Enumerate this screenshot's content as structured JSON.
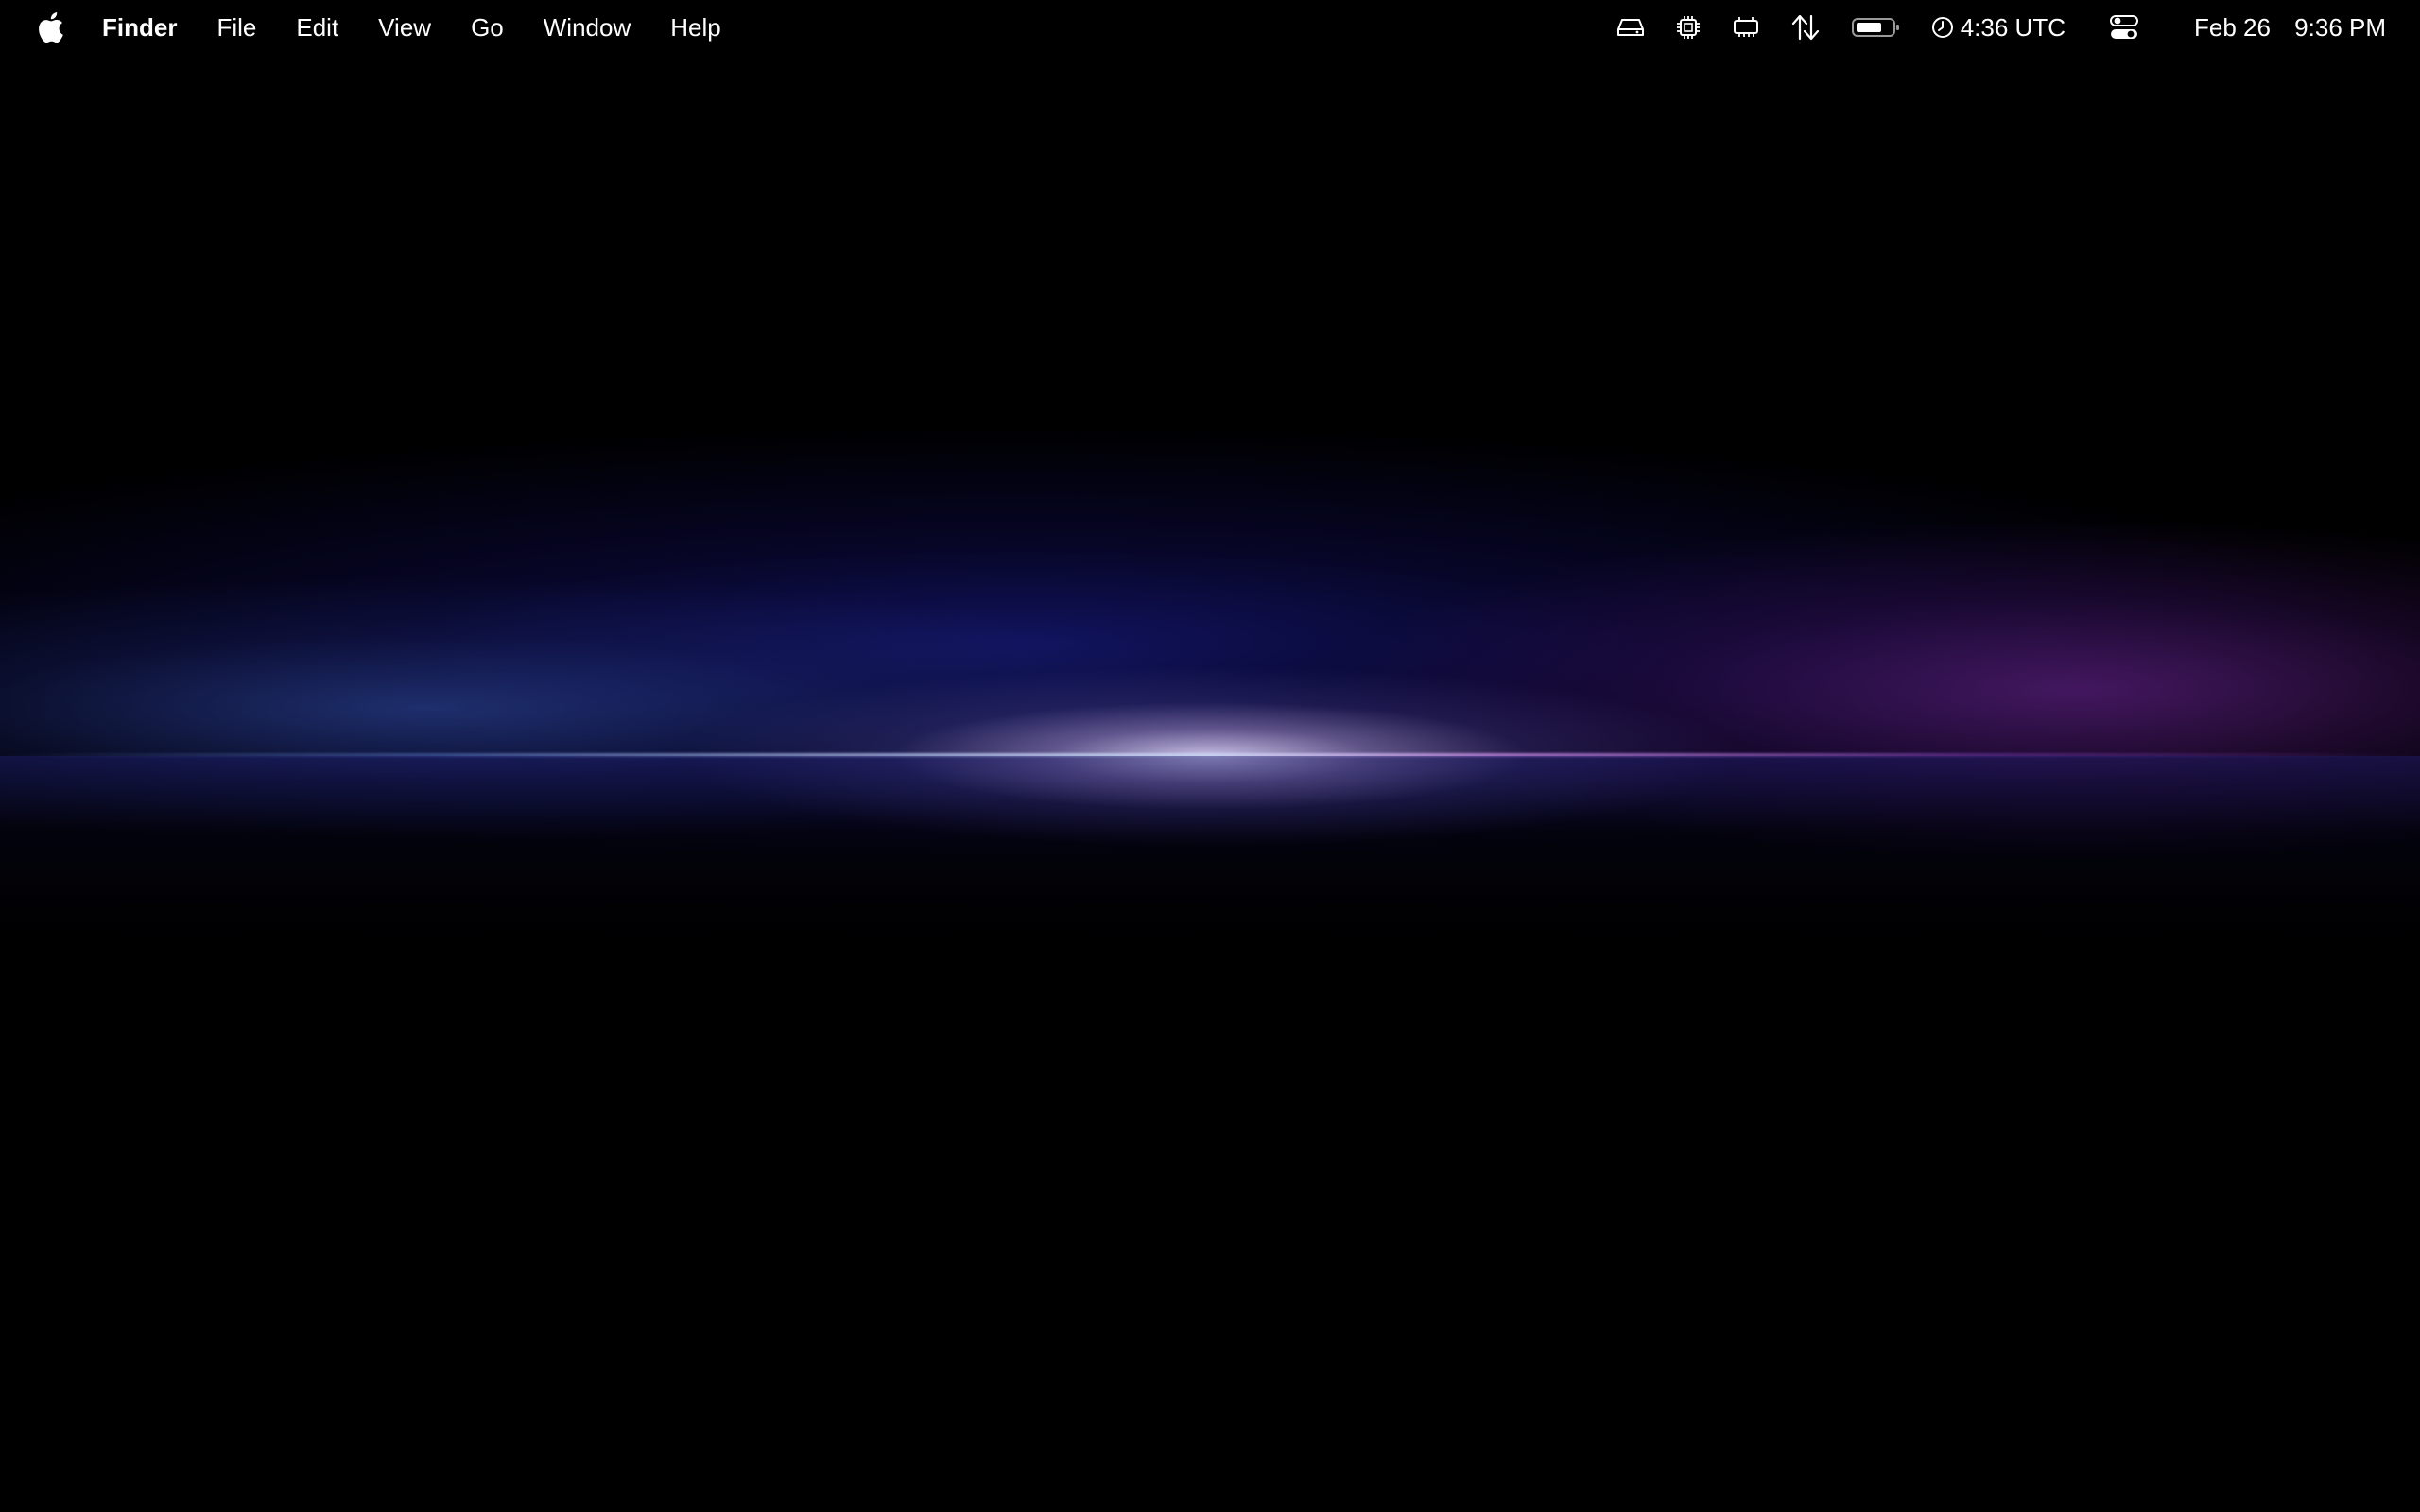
{
  "menubar": {
    "apple_icon": "apple-logo-icon",
    "app_name": "Finder",
    "menus": [
      "File",
      "Edit",
      "View",
      "Go",
      "Window",
      "Help"
    ],
    "status_icons": [
      "drive-icon",
      "cpu-chip-icon",
      "memory-icon",
      "network-arrows-icon",
      "battery-icon"
    ],
    "clock": {
      "icon": "clock-icon",
      "label": "4:36 UTC"
    },
    "control_center_icon": "control-center-icon",
    "date": "Feb 26",
    "time": "9:36 PM"
  },
  "wallpaper": {
    "colors": {
      "background": "#000000",
      "blue_glow": "#2a3f8f",
      "purple_glow": "#6a2a9a",
      "core_light": "#dcd6f5"
    }
  }
}
